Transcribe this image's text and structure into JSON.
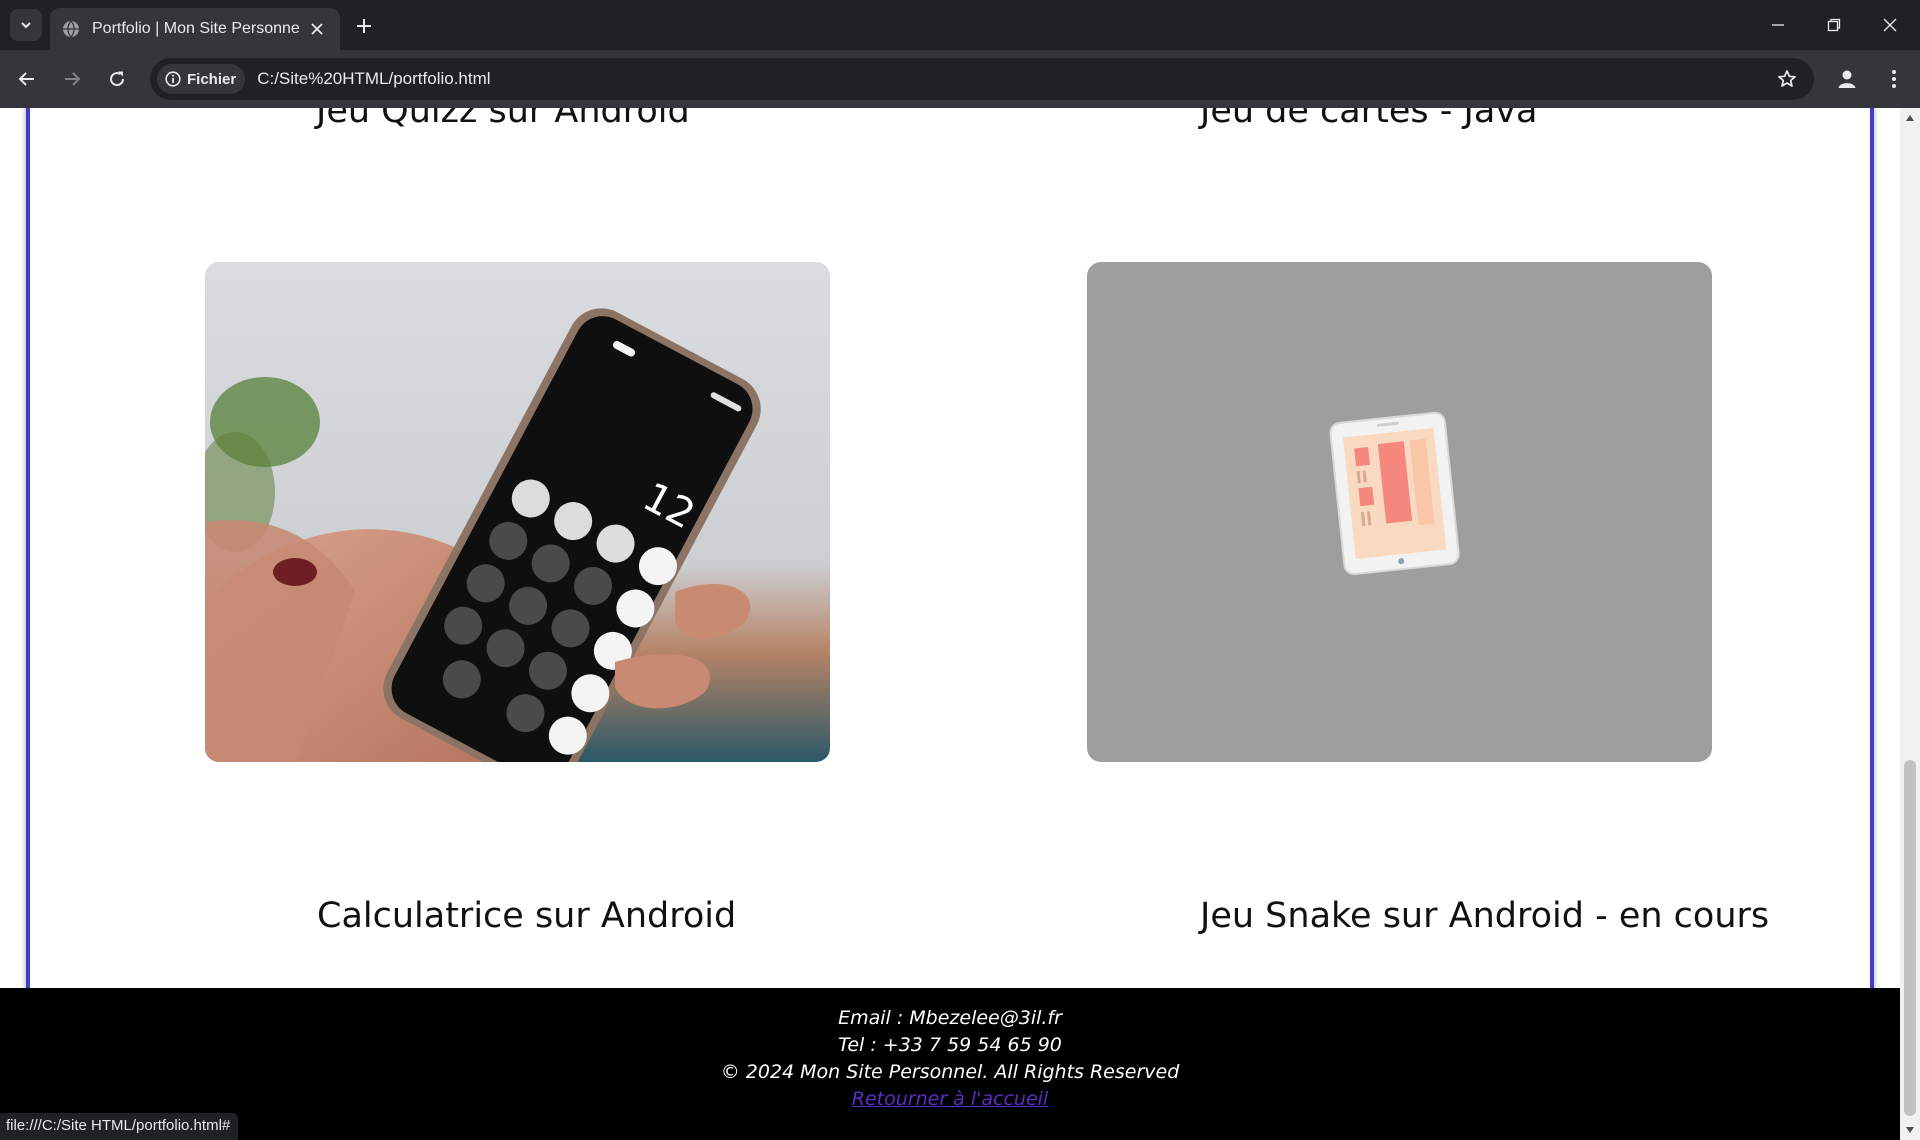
{
  "browser": {
    "tab_title": "Portfolio | Mon Site Personnel",
    "site_chip_label": "Fichier",
    "url": "C:/Site%20HTML/portfolio.html",
    "status_url": "file:///C:/Site HTML/portfolio.html#"
  },
  "projects": [
    {
      "title": "Jeu Quizz sur Android"
    },
    {
      "title": "Jeu de cartes - Java"
    },
    {
      "title": "Calculatrice sur Android",
      "image_caption": "12"
    },
    {
      "title": "Jeu Snake sur Android - en cours"
    }
  ],
  "footer": {
    "email": "Email : Mbezelee@3il.fr",
    "phone": "Tel : +33 7 59 54 65 90",
    "copyright": "© 2024 Mon Site Personnel. All Rights Reserved",
    "home_link": "Retourner à l'accueil"
  },
  "colors": {
    "card_border": "#3f3fcf",
    "footer_bg": "#000000",
    "link": "#5a2ec4",
    "placeholder_bg": "#9e9e9e"
  }
}
